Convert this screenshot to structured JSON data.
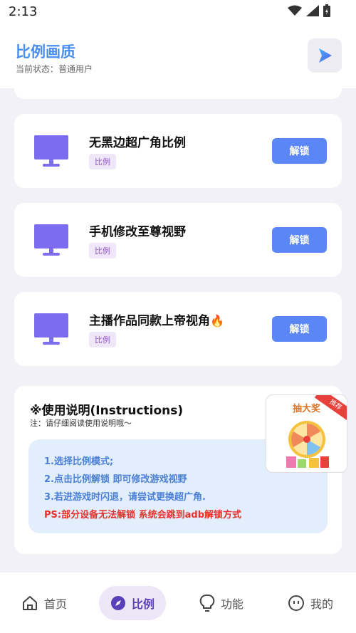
{
  "status_bar": {
    "time": "2:13"
  },
  "header": {
    "title": "比例画质",
    "subtitle": "当前状态：普通用户"
  },
  "options": [
    {
      "name": "无黑边超广角比例",
      "tag": "比例",
      "button": "解锁",
      "emoji": ""
    },
    {
      "name": "手机修改至尊视野",
      "tag": "比例",
      "button": "解锁",
      "emoji": ""
    },
    {
      "name": "主播作品同款上帝视角",
      "tag": "比例",
      "button": "解锁",
      "emoji": "🔥"
    }
  ],
  "instructions": {
    "heading": "※使用说明(Instructions)",
    "note": "注：请仔细阅读使用说明哦～",
    "lines": [
      "1.选择比例模式;",
      "2.点击比例解锁 即可修改游戏视野",
      "3.若进游戏时闪退，请尝试更换超广角."
    ],
    "ps": "PS:部分设备无法解锁 系统会跳到adb解锁方式"
  },
  "promo": {
    "title": "抽大奖",
    "ribbon": "推荐"
  },
  "tabs": [
    {
      "label": "首页",
      "icon": "home-icon"
    },
    {
      "label": "比例",
      "icon": "compass-icon"
    },
    {
      "label": "功能",
      "icon": "lightbulb-icon"
    },
    {
      "label": "我的",
      "icon": "face-icon"
    }
  ],
  "active_tab": "比例",
  "colors": {
    "accent": "#5b87f6",
    "title_blue": "#4a8ef0",
    "monitor_purple": "#7b6cf0",
    "ps_red": "#e8302a"
  }
}
